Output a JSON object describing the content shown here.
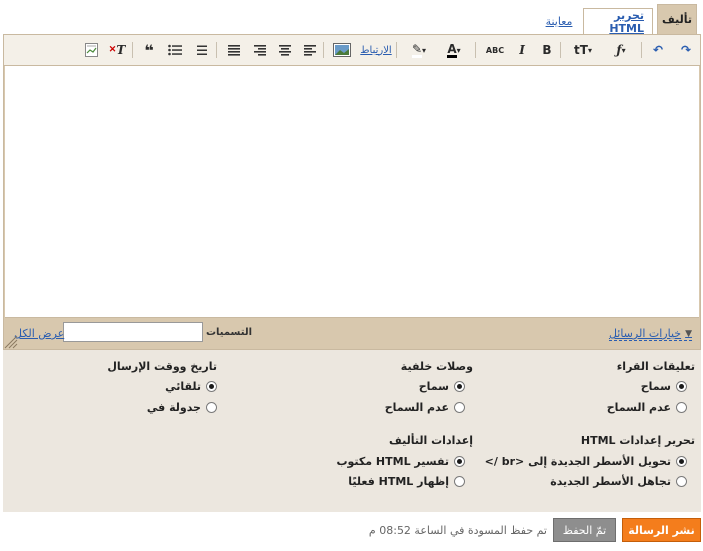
{
  "tabs": {
    "compose": "تأليف",
    "html": "تحرير HTML",
    "preview": "معاينة"
  },
  "toolbar": {
    "bold": "B",
    "italic": "I",
    "spell": "ABC",
    "link": "الارتباط",
    "font": "ƒ",
    "size": "tT",
    "text_color": "A"
  },
  "labels": {
    "options_link": "خيارات الرسائل",
    "caption": "التسميات :",
    "value": "",
    "show_all": "عرض الكل"
  },
  "settings": {
    "reader_comments": {
      "title": "تعليقات القراء",
      "allow": "سماح",
      "deny": "عدم السماح"
    },
    "backlinks": {
      "title": "وصلات خلفية",
      "allow": "سماح",
      "deny": "عدم السماح"
    },
    "post_date": {
      "title": "تاريخ ووقت الإرسال",
      "auto": "تلقائي",
      "schedule": "جدولة في"
    },
    "html_edit": {
      "title": "تحرير إعدادات HTML",
      "convert": "تحويل الأسطر الجديدة إلى <br />",
      "ignore": "تجاهل الأسطر الجديدة"
    },
    "compose": {
      "title": "إعدادات التأليف",
      "interpret": "تفسير HTML مكتوب",
      "show": "إظهار HTML فعليًا"
    }
  },
  "footer": {
    "publish": "نشر الرسالة",
    "saved": "تمّ الحفظ",
    "status": "تم حفظ المسودة في الساعة 08:52 م"
  },
  "colors": {
    "accent": "#f47d1c",
    "panel": "#ece7df",
    "frame": "#d8c8ae",
    "link": "#2a5db0"
  }
}
